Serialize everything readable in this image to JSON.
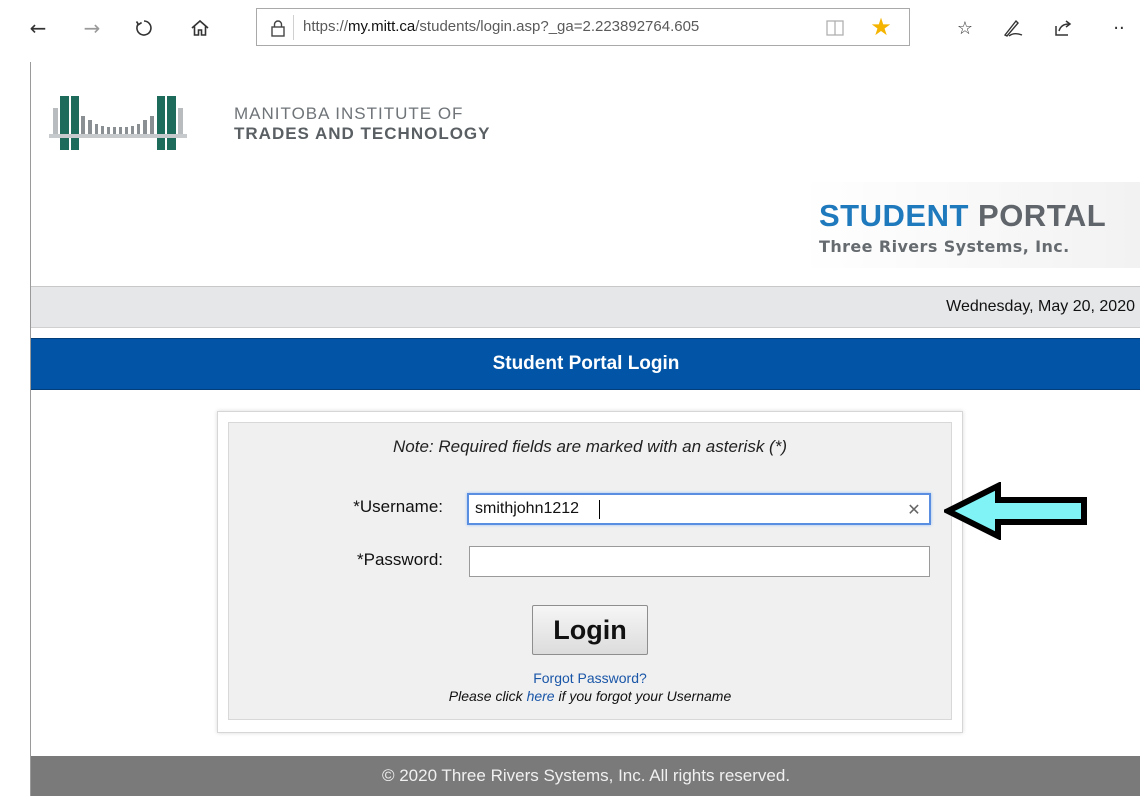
{
  "browser": {
    "url_prefix": "https://",
    "url_domain": "my.mitt.ca",
    "url_rest": "/students/login.asp?_ga=2.223892764.605",
    "icons": {
      "back": "arrow-left-icon",
      "forward": "arrow-right-icon",
      "refresh": "refresh-icon",
      "home": "home-icon",
      "lock": "lock-icon",
      "reading_view": "reading-view-icon",
      "favorite": "star-icon",
      "favorites_hub": "favorites-list-icon",
      "notes": "pen-icon",
      "share": "share-icon",
      "more": "more-icon"
    },
    "colors": {
      "favorite_star": "#f5b400"
    }
  },
  "header": {
    "institute_line1": "MANITOBA INSTITUTE OF",
    "institute_line2": "TRADES AND TECHNOLOGY",
    "portal_word1": "STUDENT",
    "portal_word2": "PORTAL",
    "portal_company": "Three Rivers Systems, Inc."
  },
  "date_bar": {
    "date": "Wednesday, May 20, 2020"
  },
  "title_bar": {
    "title": "Student Portal Login"
  },
  "login": {
    "note": "Note: Required fields are marked with an asterisk (*)",
    "username_label": "*Username:",
    "username_value": "smithjohn1212",
    "password_label": "*Password:",
    "password_value": "",
    "login_button": "Login",
    "forgot_password": "Forgot Password?",
    "help_prefix": "Please click ",
    "help_link": "here",
    "help_suffix": " if you forgot your Username"
  },
  "footer": {
    "copyright": "© 2020 Three Rivers Systems, Inc. All rights reserved."
  },
  "colors": {
    "title_bar": "#0255a6",
    "brand_blue": "#1f79bd",
    "logo_teal": "#1c6b5b",
    "arrow_fill": "#7ff3f5",
    "footer": "#7a7a7a"
  }
}
